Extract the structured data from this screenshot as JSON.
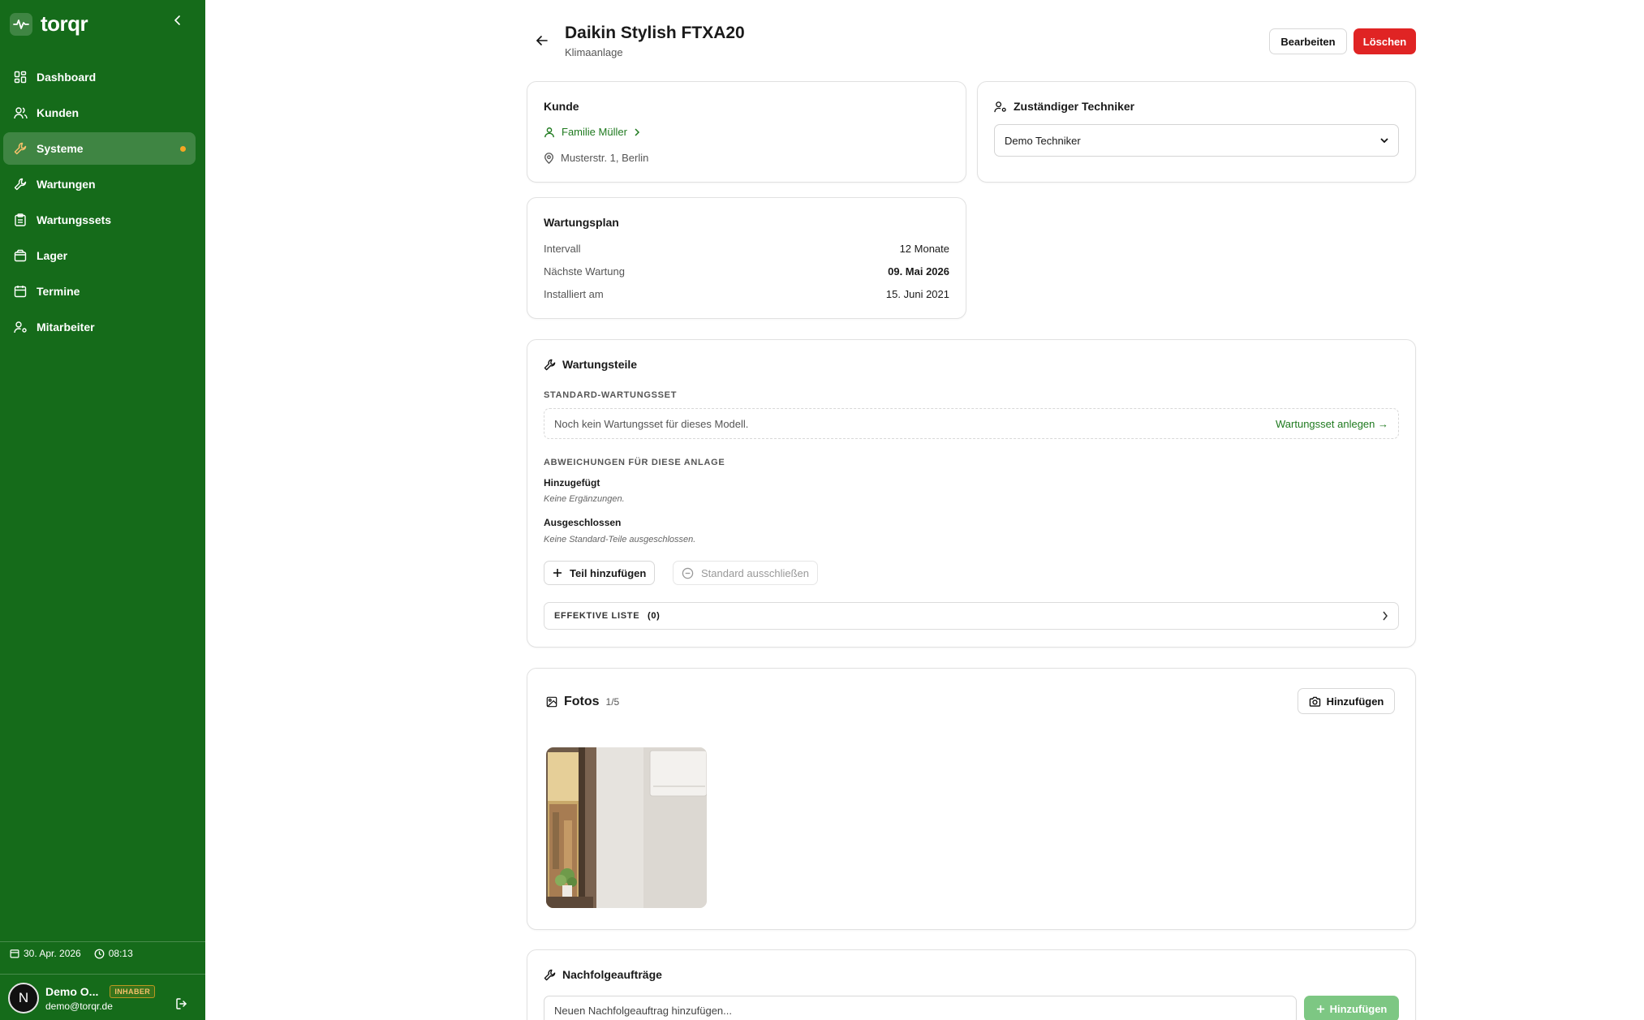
{
  "app": {
    "name": "torqr"
  },
  "sidebar": {
    "items": [
      {
        "label": "Dashboard",
        "icon": "grid-icon"
      },
      {
        "label": "Kunden",
        "icon": "users-icon"
      },
      {
        "label": "Systeme",
        "icon": "wrench-icon",
        "active": true
      },
      {
        "label": "Wartungen",
        "icon": "wrench-icon"
      },
      {
        "label": "Wartungssets",
        "icon": "clipboard-icon"
      },
      {
        "label": "Lager",
        "icon": "package-icon"
      },
      {
        "label": "Termine",
        "icon": "calendar-icon"
      },
      {
        "label": "Mitarbeiter",
        "icon": "user-cog-icon"
      }
    ],
    "date": "30. Apr. 2026",
    "time": "08:13",
    "user": {
      "initial": "N",
      "name": "Demo O...",
      "role": "INHABER",
      "email": "demo@torqr.de"
    }
  },
  "header": {
    "title": "Daikin Stylish FTXA20",
    "subtitle": "Klimaanlage",
    "edit_label": "Bearbeiten",
    "delete_label": "Löschen"
  },
  "customer_card": {
    "heading": "Kunde",
    "name": "Familie Müller",
    "address": "Musterstr. 1, Berlin"
  },
  "technician_card": {
    "heading": "Zuständiger Techniker",
    "selected": "Demo Techniker"
  },
  "plan_card": {
    "heading": "Wartungsplan",
    "rows": [
      {
        "label": "Intervall",
        "value": "12 Monate"
      },
      {
        "label": "Nächste Wartung",
        "value": "09. Mai 2026"
      },
      {
        "label": "Installiert am",
        "value": "15. Juni 2021"
      }
    ]
  },
  "parts_card": {
    "heading": "Wartungsteile",
    "standard_caption": "STANDARD-WARTUNGSSET",
    "empty_text": "Noch kein Wartungsset für dieses Modell.",
    "create_link": "Wartungsset anlegen →",
    "deviations_caption": "ABWEICHUNGEN FÜR DIESE ANLAGE",
    "added_heading": "Hinzugefügt",
    "added_empty": "Keine Ergänzungen.",
    "excluded_heading": "Ausgeschlossen",
    "excluded_empty": "Keine Standard-Teile ausgeschlossen.",
    "add_part_label": "Teil hinzufügen",
    "exclude_label": "Standard ausschließen",
    "effective_label": "EFFEKTIVE LISTE",
    "effective_count": "(0)"
  },
  "photos_card": {
    "heading": "Fotos",
    "count": "1/5",
    "add_label": "Hinzufügen"
  },
  "followups_card": {
    "heading": "Nachfolgeaufträge",
    "placeholder": "Neuen Nachfolgeauftrag hinzufügen...",
    "add_label": "Hinzufügen"
  },
  "colors": {
    "brand": "#156b1a",
    "danger": "#e02424",
    "accent_dot": "#f5a623",
    "link": "#1f7a1f"
  }
}
